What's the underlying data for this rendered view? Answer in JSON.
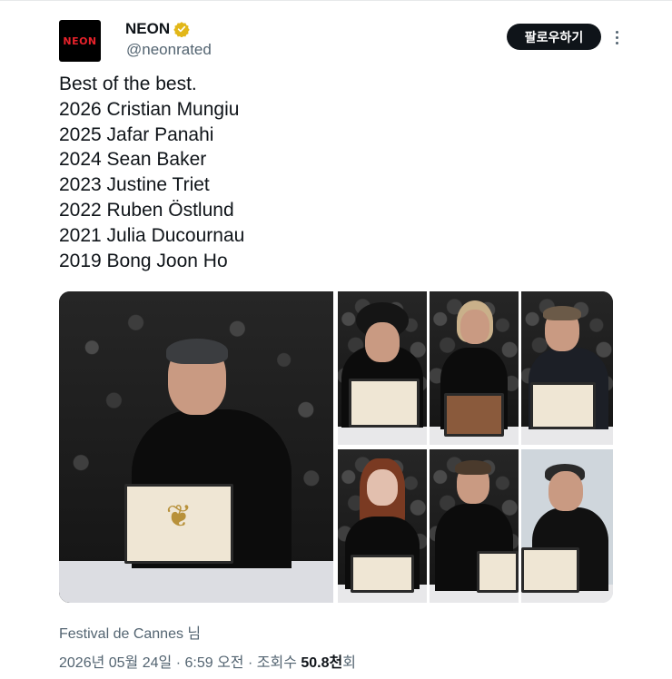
{
  "profile": {
    "avatar_text": "NEON",
    "display_name": "NEON",
    "handle": "@neonrated",
    "verified_icon": "verified-badge-icon",
    "verified_color": "#e2b719"
  },
  "actions": {
    "follow_label": "팔로우하기",
    "more_icon": "more-dots-icon"
  },
  "tweet": {
    "lines": [
      "Best of the best.",
      "2026 Cristian Mungiu",
      "2025 Jafar Panahi",
      "2024 Sean Baker",
      "2023 Justine Triet",
      "2022 Ruben Östlund",
      "2021 Julia Ducournau",
      "2019 Bong Joon Ho"
    ]
  },
  "source": {
    "label": "Festival de Cannes 님"
  },
  "meta": {
    "date": "2026년 05월 24일",
    "sep1": "·",
    "time": "6:59 오전",
    "sep2": "·",
    "views_label": "조회수",
    "views_value": "50.8천",
    "views_unit": "회"
  },
  "colors": {
    "text_primary": "#0f1419",
    "text_secondary": "#536471",
    "brand_red": "#e8222b"
  }
}
